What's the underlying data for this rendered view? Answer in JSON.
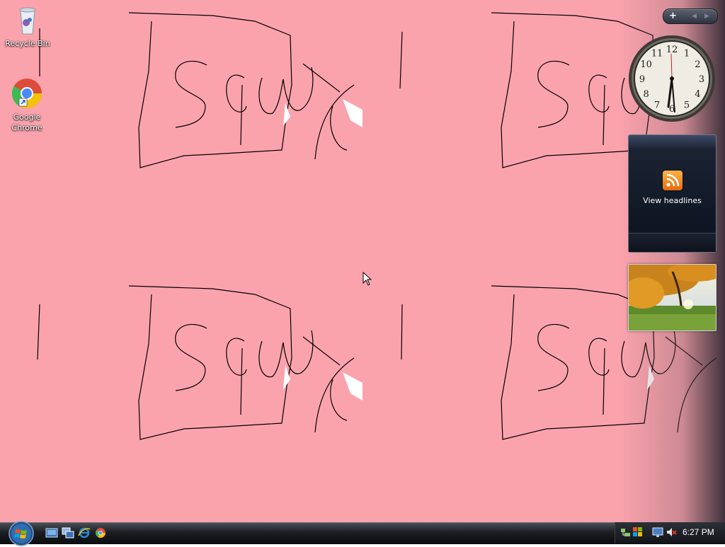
{
  "desktop": {
    "background_color": "#fba3ad",
    "icons": [
      {
        "label": "Recycle Bin",
        "icon": "recycle-bin-icon"
      },
      {
        "label": "Google Chrome",
        "icon": "chrome-icon"
      }
    ]
  },
  "sidebar": {
    "controls": {
      "add": "+",
      "prev": "◀",
      "next": "▶"
    },
    "clock": {
      "numbers": [
        "12",
        "1",
        "2",
        "3",
        "4",
        "5",
        "6",
        "7",
        "8",
        "9",
        "10",
        "11"
      ]
    },
    "feed": {
      "label": "View headlines",
      "icon": "rss-icon"
    },
    "slideshow": {
      "icon": "photo-icon"
    }
  },
  "taskbar": {
    "start_icon": "windows-start-orb",
    "quick_launch": [
      "show-desktop-icon",
      "switch-windows-icon",
      "internet-explorer-icon",
      "chrome-icon"
    ],
    "tray_icons": [
      "network-icon",
      "windows-update-icon",
      "display-icon",
      "volume-muted-icon"
    ],
    "time": "6:27 PM"
  }
}
